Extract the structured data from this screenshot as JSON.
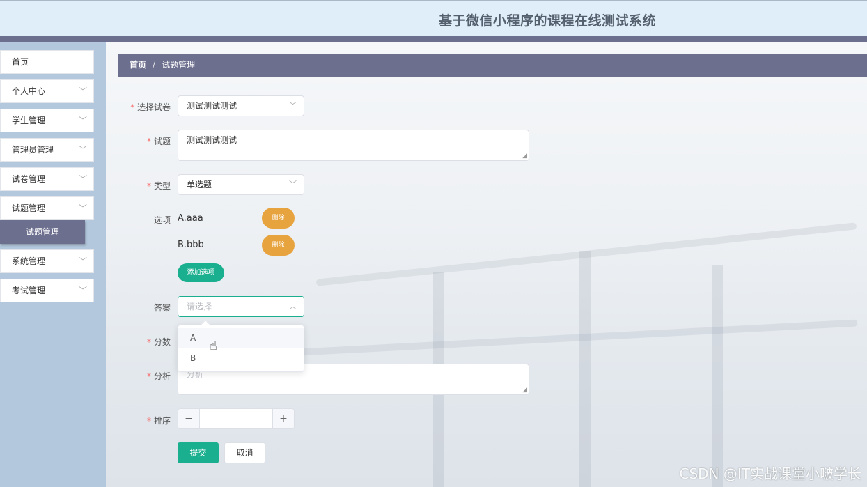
{
  "header": {
    "title": "基于微信小程序的课程在线测试系统"
  },
  "sidebar": {
    "items": [
      {
        "label": "首页",
        "has_chevron": false
      },
      {
        "label": "个人中心",
        "has_chevron": true
      },
      {
        "label": "学生管理",
        "has_chevron": true
      },
      {
        "label": "管理员管理",
        "has_chevron": true
      },
      {
        "label": "试卷管理",
        "has_chevron": true
      },
      {
        "label": "试题管理",
        "has_chevron": true
      },
      {
        "label": "系统管理",
        "has_chevron": true
      },
      {
        "label": "考试管理",
        "has_chevron": true
      }
    ],
    "active_sub": "试题管理",
    "chevron_icon": "chevron-down-icon"
  },
  "breadcrumb": {
    "home": "首页",
    "separator": "/",
    "current": "试题管理"
  },
  "form": {
    "paper": {
      "label": "选择试卷",
      "value": "测试测试测试"
    },
    "question": {
      "label": "试题",
      "value": "测试测试测试"
    },
    "type": {
      "label": "类型",
      "value": "单选题"
    },
    "options": {
      "label": "选项",
      "items": [
        {
          "text": "A.aaa"
        },
        {
          "text": "B.bbb"
        }
      ],
      "delete_label": "删除",
      "add_label": "添加选项"
    },
    "answer": {
      "label": "答案",
      "placeholder": "请选择",
      "dropdown": [
        "A",
        "B"
      ],
      "hovered": "A"
    },
    "score": {
      "label": "分数"
    },
    "analysis": {
      "label": "分析",
      "placeholder": "分析"
    },
    "order": {
      "label": "排序",
      "minus": "−",
      "plus": "+",
      "value": ""
    },
    "submit_label": "提交",
    "cancel_label": "取消"
  },
  "watermark": "CSDN @IT实战课堂小啵学长",
  "colors": {
    "accent": "#1aaf8f",
    "primary_bar": "#6c6f8e",
    "danger_button": "#e7a33e",
    "required": "#f56c6c"
  }
}
